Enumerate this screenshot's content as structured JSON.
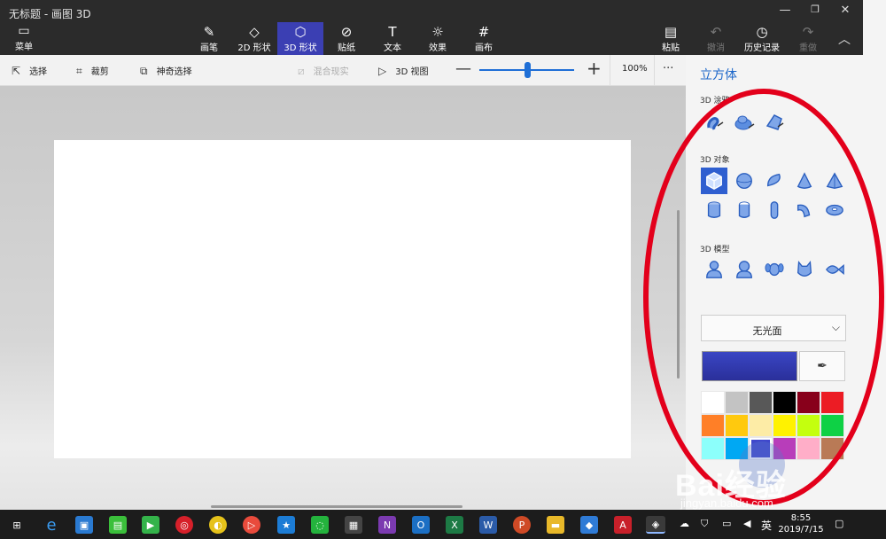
{
  "window": {
    "title": "无标题 - 画图 3D",
    "controls": [
      "minimize-icon",
      "restore-icon",
      "close-icon"
    ]
  },
  "ribbon": {
    "menu_label": "菜单",
    "tools": [
      {
        "label": "画笔",
        "icon": "brush-icon",
        "glyph": "✎"
      },
      {
        "label": "2D 形状",
        "icon": "2d-shapes-icon",
        "glyph": "◇"
      },
      {
        "label": "3D 形状",
        "icon": "3d-shapes-icon",
        "glyph": "⬡"
      },
      {
        "label": "贴纸",
        "icon": "sticker-icon",
        "glyph": "⊘"
      },
      {
        "label": "文本",
        "icon": "text-icon",
        "glyph": "T"
      },
      {
        "label": "效果",
        "icon": "effects-icon",
        "glyph": "☼"
      },
      {
        "label": "画布",
        "icon": "canvas-icon",
        "glyph": "#"
      }
    ],
    "paste_label": "粘贴",
    "undo_label": "撤消",
    "history_label": "历史记录",
    "redo_label": "重做"
  },
  "subtoolbar": {
    "select_label": "选择",
    "crop_label": "裁剪",
    "magic_select_label": "神奇选择",
    "mixed_reality_label": "混合现实",
    "view3d_label": "3D 视图",
    "zoom_value": "100%",
    "zoom_level": 0.5,
    "more_label": "···"
  },
  "panel": {
    "title": "立方体",
    "doodle_label": "3D 涂鸦",
    "objects_label": "3D 对象",
    "models_label": "3D 模型",
    "finish_value": "无光面",
    "current_color": "#3a46c4",
    "swatches": [
      "#ffffff",
      "#c3c3c3",
      "#585858",
      "#000000",
      "#88001b",
      "#ec1c24",
      "#ff7f27",
      "#ffc90e",
      "#fdeca6",
      "#fff200",
      "#c4ff0e",
      "#0ed145",
      "#8cfffb",
      "#00a8f3",
      "#3f48cc",
      "#b83dba",
      "#ffaec8",
      "#b97a56"
    ]
  },
  "watermark": {
    "brand": "Bai经验",
    "url": "jingyan.baidu.com"
  },
  "taskbar": {
    "language": "英",
    "time": "8:55",
    "date": "2019/7/15"
  }
}
